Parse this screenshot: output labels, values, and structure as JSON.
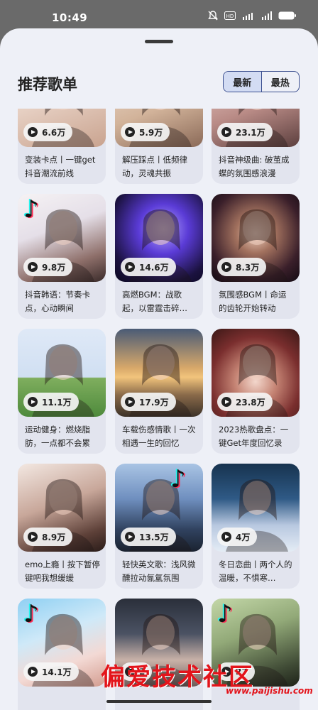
{
  "status_bar": {
    "time": "10:49",
    "battery": "100"
  },
  "header": {
    "title": "推荐歌单"
  },
  "sort_tabs": [
    {
      "label": "最新",
      "active": true
    },
    {
      "label": "最热",
      "active": false
    }
  ],
  "playlists": [
    {
      "plays": "6.6万",
      "title": "变装卡点丨一键get抖音潮流前线",
      "cover": "tiktok-dancer"
    },
    {
      "plays": "5.9万",
      "title": "解压踩点丨低频律动，灵魂共振",
      "cover": "portrait-warm"
    },
    {
      "plays": "23.1万",
      "title": "抖音神级曲: 破茧成蝶的氛围感浪漫",
      "cover": "tiktok-portrait"
    },
    {
      "plays": "9.8万",
      "title": "抖音韩语：节奏卡点，心动瞬间",
      "cover": "tiktok-girl"
    },
    {
      "plays": "14.6万",
      "title": "高燃BGM：战歌起，以雷霆击碎…",
      "cover": "anime-lightning"
    },
    {
      "plays": "8.3万",
      "title": "氛围感BGM丨命运的齿轮开始转动",
      "cover": "portrait-night"
    },
    {
      "plays": "11.1万",
      "title": "运动健身：燃烧脂肪，一点都不会累",
      "cover": "runner"
    },
    {
      "plays": "17.9万",
      "title": "车载伤感情歌丨一次相遇一生的回忆",
      "cover": "truck-sunset"
    },
    {
      "plays": "23.8万",
      "title": "2023热歌盘点：一键Get年度回忆录",
      "cover": "flower-crown"
    },
    {
      "plays": "8.9万",
      "title": "emo上瘾丨按下暂停键吧我想缓缓",
      "cover": "anime-girl"
    },
    {
      "plays": "13.5万",
      "title": "轻快英文歌：浅风微醺拉动氤氲氛围",
      "cover": "tiktok-city"
    },
    {
      "plays": "4万",
      "title": "冬日恋曲丨两个人的温暖，不惧寒…",
      "cover": "winter-couple"
    },
    {
      "plays": "14.1万",
      "title": "",
      "cover": "tiktok-bow"
    },
    {
      "plays": "2",
      "title": "",
      "cover": "portrait-dark"
    },
    {
      "plays": "27",
      "title": "",
      "cover": "tiktok-headphones"
    }
  ],
  "watermark": {
    "text": "偏爱技术社区",
    "url": "www.paijishu.com"
  },
  "colors": {
    "accent": "#3b4f8f",
    "active_tab_bg": "#d3dcf3",
    "sheet_bg": "#eef0f7",
    "watermark": "#e3141b"
  }
}
